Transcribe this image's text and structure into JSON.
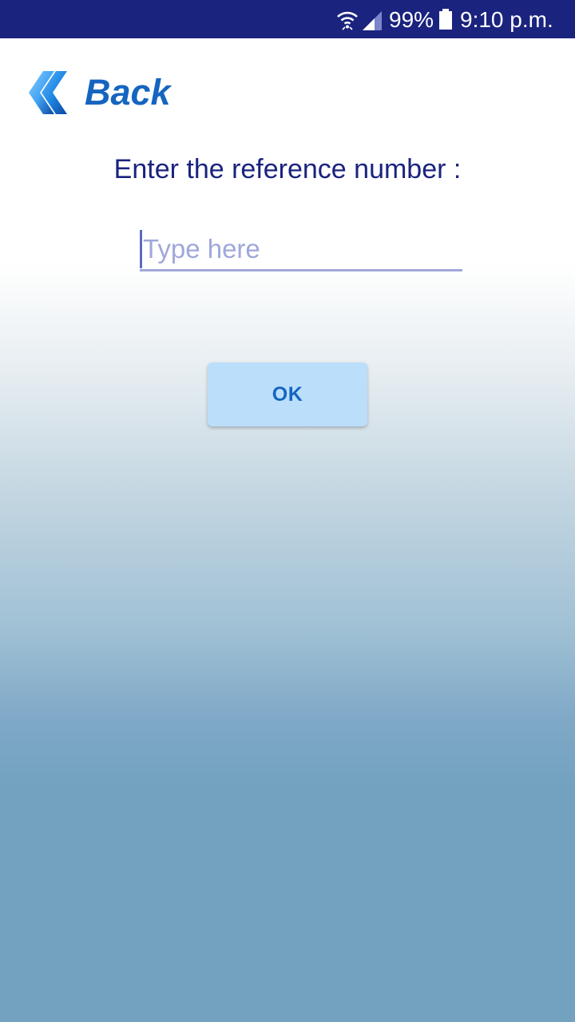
{
  "status_bar": {
    "battery_percent": "99%",
    "time": "9:10 p.m.",
    "icons": [
      "wifi-icon",
      "signal-icon",
      "battery-icon"
    ]
  },
  "nav": {
    "back_label": "Back",
    "back_icon": "double-chevron-left-icon"
  },
  "form": {
    "prompt": "Enter the reference number :",
    "input_value": "",
    "input_placeholder": "Type here",
    "ok_label": "OK"
  },
  "colors": {
    "status_bar": "#1a237e",
    "accent": "#1565c0",
    "text": "#1a237e",
    "input_underline": "#9fa8da",
    "button_bg": "#bbdefb",
    "gradient_bottom": "#72a2c0"
  }
}
